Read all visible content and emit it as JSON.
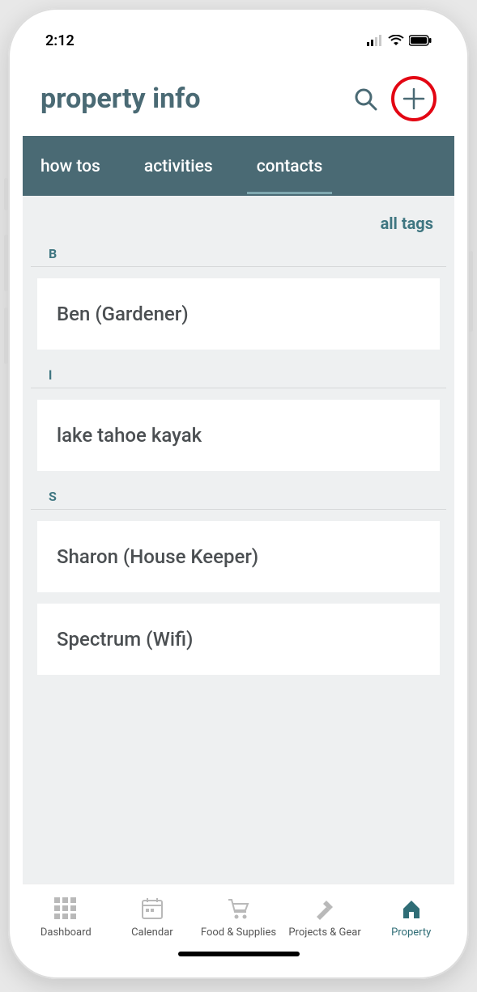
{
  "status": {
    "time": "2:12"
  },
  "header": {
    "title": "property info"
  },
  "tabs": [
    {
      "label": "how tos",
      "active": false
    },
    {
      "label": "activities",
      "active": false
    },
    {
      "label": "contacts",
      "active": true
    }
  ],
  "filter": {
    "label": "all tags"
  },
  "sections": [
    {
      "letter": "B",
      "items": [
        {
          "name": "Ben (Gardener)"
        }
      ]
    },
    {
      "letter": "l",
      "items": [
        {
          "name": "lake tahoe kayak"
        }
      ]
    },
    {
      "letter": "S",
      "items": [
        {
          "name": "Sharon (House Keeper)"
        },
        {
          "name": "Spectrum (Wifi)"
        }
      ]
    }
  ],
  "bottomNav": [
    {
      "label": "Dashboard",
      "icon": "grid",
      "active": false
    },
    {
      "label": "Calendar",
      "icon": "calendar",
      "active": false
    },
    {
      "label": "Food & Supplies",
      "icon": "cart",
      "active": false
    },
    {
      "label": "Projects & Gear",
      "icon": "hammer",
      "active": false
    },
    {
      "label": "Property",
      "icon": "home",
      "active": true
    }
  ]
}
